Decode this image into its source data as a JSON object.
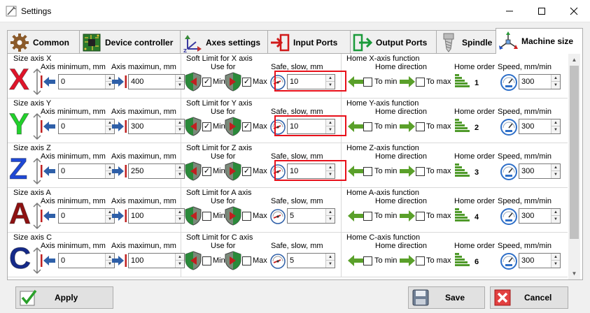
{
  "window": {
    "title": "Settings"
  },
  "tabs": [
    {
      "label": "Common",
      "icon": "gear-icon",
      "active": false
    },
    {
      "label": "Device controller",
      "icon": "circuit-board-icon",
      "active": false
    },
    {
      "label": "Axes settings",
      "icon": "axes-icon",
      "active": false
    },
    {
      "label": "Input Ports",
      "icon": "input-arrow-icon",
      "active": false
    },
    {
      "label": "Output Ports",
      "icon": "output-arrow-icon",
      "active": false
    },
    {
      "label": "Spindle",
      "icon": "spindle-icon",
      "active": false
    },
    {
      "label": "Machine size",
      "icon": "machine-size-icon",
      "active": true
    }
  ],
  "labels": {
    "axis_min": "Axis minimum, mm",
    "axis_max": "Axis maximun, mm",
    "use_for": "Use for",
    "min": "Min",
    "max": "Max",
    "safe_slow": "Safe, slow, mm",
    "home_direction": "Home direction",
    "home_order": "Home order",
    "speed": "Speed, mm/min",
    "to_min": "To min",
    "to_max": "To max"
  },
  "axes": [
    {
      "letter": "X",
      "color": "#e0142a",
      "size_title": "Size axis X",
      "soft_title": "Soft Limit for X axis",
      "home_title": "Home X-axis function",
      "axis_min": "0",
      "axis_max": "400",
      "soft_min": true,
      "soft_max": true,
      "safe_slow": "10",
      "highlight": true,
      "to_min": false,
      "to_max": false,
      "home_order": "1",
      "speed": "300"
    },
    {
      "letter": "Y",
      "color": "#22d12c",
      "size_title": "Size axis Y",
      "soft_title": "Soft Limit for Y axis",
      "home_title": "Home Y-axis function",
      "axis_min": "0",
      "axis_max": "300",
      "soft_min": true,
      "soft_max": true,
      "safe_slow": "10",
      "highlight": true,
      "to_min": false,
      "to_max": false,
      "home_order": "2",
      "speed": "300"
    },
    {
      "letter": "Z",
      "color": "#1f49d6",
      "size_title": "Size axis Z",
      "soft_title": "Soft Limit for Z axis",
      "home_title": "Home Z-axis function",
      "axis_min": "0",
      "axis_max": "250",
      "soft_min": true,
      "soft_max": true,
      "safe_slow": "10",
      "highlight": true,
      "to_min": false,
      "to_max": false,
      "home_order": "3",
      "speed": "300"
    },
    {
      "letter": "A",
      "color": "#8e1212",
      "size_title": "Size axis A",
      "soft_title": "Soft Limit for A axis",
      "home_title": "Home A-axis function",
      "axis_min": "0",
      "axis_max": "100",
      "soft_min": false,
      "soft_max": false,
      "safe_slow": "5",
      "highlight": false,
      "to_min": false,
      "to_max": false,
      "home_order": "4",
      "speed": "300"
    },
    {
      "letter": "C",
      "color": "#152a8a",
      "size_title": "Size axis C",
      "soft_title": "Soft Limit for C axis",
      "home_title": "Home C-axis function",
      "axis_min": "0",
      "axis_max": "100",
      "soft_min": false,
      "soft_max": false,
      "safe_slow": "5",
      "highlight": false,
      "to_min": false,
      "to_max": false,
      "home_order": "6",
      "speed": "300"
    }
  ],
  "footer": {
    "apply": "Apply",
    "save": "Save",
    "cancel": "Cancel"
  }
}
